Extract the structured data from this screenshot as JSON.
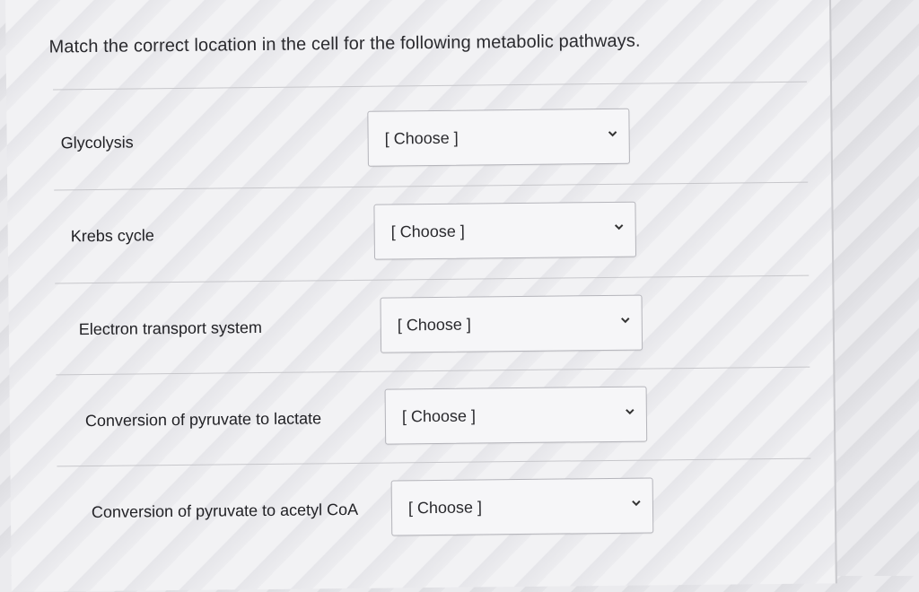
{
  "question": {
    "text": "Match the correct location in the cell for the following metabolic pathways."
  },
  "rows": [
    {
      "label": "Glycolysis",
      "selected": "[ Choose ]"
    },
    {
      "label": "Krebs cycle",
      "selected": "[ Choose ]"
    },
    {
      "label": "Electron transport system",
      "selected": "[ Choose ]"
    },
    {
      "label": "Conversion of pyruvate to lactate",
      "selected": "[ Choose ]"
    },
    {
      "label": "Conversion of pyruvate to acetyl CoA",
      "selected": "[ Choose ]"
    }
  ],
  "icons": {
    "dropdown": "chevron-down-icon"
  }
}
